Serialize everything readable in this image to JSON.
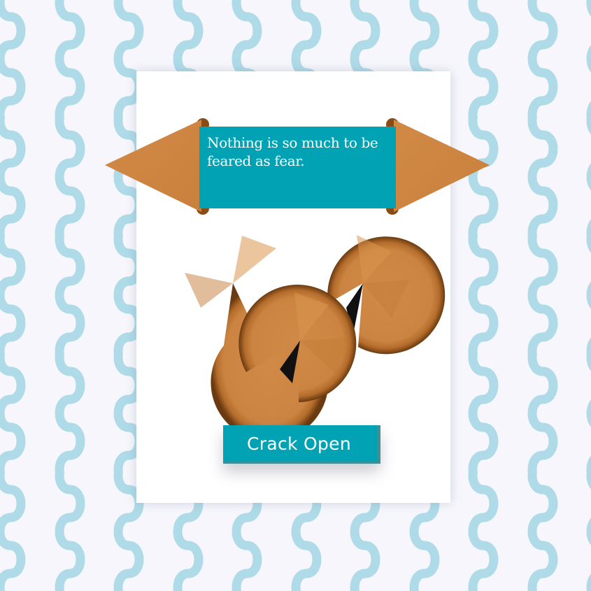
{
  "fortune": {
    "message": "Nothing is so much to be feared as fear."
  },
  "controls": {
    "crack_button_label": "Crack Open"
  },
  "icons": {
    "cookie": "fortune-cookie-icon",
    "pattern": "wavy-line-pattern"
  },
  "colors": {
    "page_background": "#f6f6fc",
    "wave_pattern": "#aedbe7",
    "accent_teal": "#00a2b4",
    "button_shadow_edge": "#3f8f97",
    "cookie_brown": "#cd8743",
    "cookie_dark": "#7a4413",
    "text_on_accent": "#ffffff"
  }
}
